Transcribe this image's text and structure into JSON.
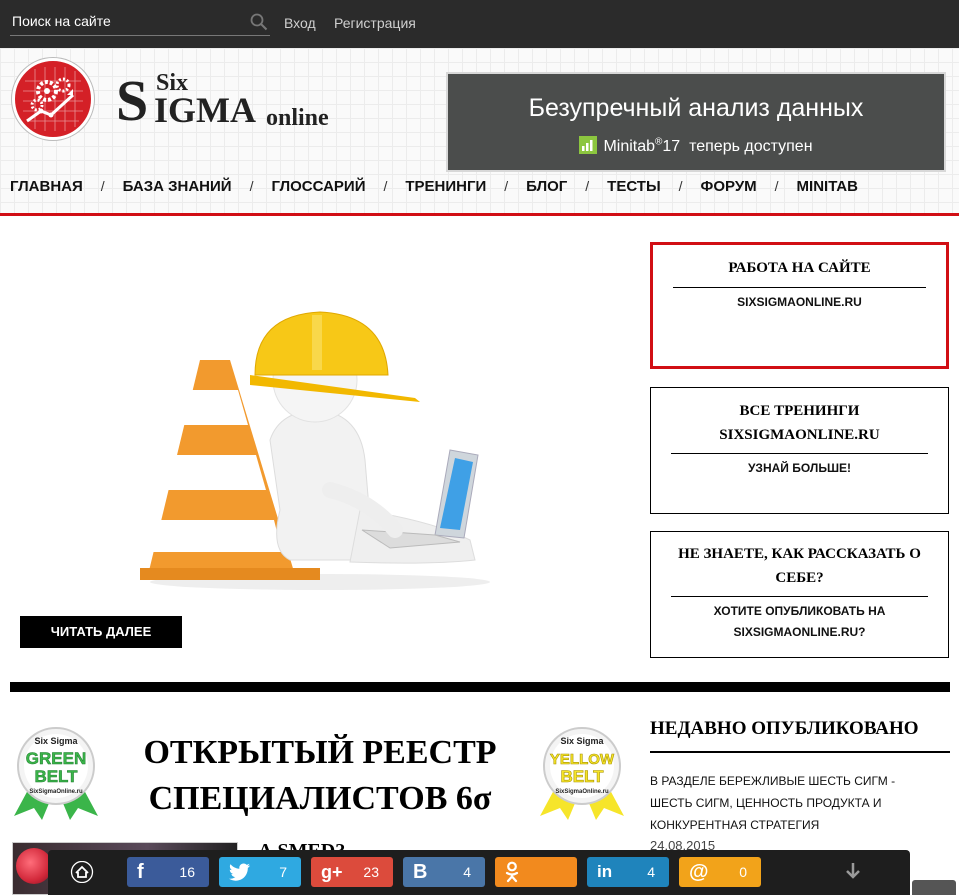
{
  "topbar": {
    "search_placeholder": "Поиск на сайте",
    "login": "Вход",
    "register": "Регистрация"
  },
  "logo": {
    "six": "Six",
    "s": "S",
    "igma": "IGMA",
    "online": "online"
  },
  "banner": {
    "title": "Безупречный анализ данных",
    "product": "Minitab",
    "version": "17",
    "available": "теперь доступен"
  },
  "nav": {
    "items": [
      "ГЛАВНАЯ",
      "БАЗА ЗНАНИЙ",
      "ГЛОССАРИЙ",
      "ТРЕНИНГИ",
      "БЛОГ",
      "ТЕСТЫ",
      "ФОРУМ",
      "MINITAB"
    ],
    "separator": "/"
  },
  "hero": {
    "read_more": "ЧИТАТЬ ДАЛЕЕ"
  },
  "sidebar": {
    "boxes": [
      {
        "title": "РАБОТА НА САЙТЕ",
        "link": "SIXSIGMAONLINE.RU"
      },
      {
        "title": "ВСЕ ТРЕНИНГИ SIXSIGMAONLINE.RU",
        "link": "УЗНАЙ БОЛЬШЕ!"
      },
      {
        "title": "НЕ ЗНАЕТЕ, КАК РАССКАЗАТЬ О СЕБЕ?",
        "link": "ХОТИТЕ ОПУБЛИКОВАТЬ НА SIXSIGMAONLINE.RU?"
      }
    ]
  },
  "registry": {
    "title": "ОТКРЫТЫЙ РЕЕСТР СПЕЦИАЛИСТОВ 6σ",
    "green_badge": {
      "top": "Six Sigma",
      "line1": "GREEN",
      "line2": "BELT",
      "site": "SixSigmaOnline.ru"
    },
    "yellow_badge": {
      "top": "Six Sigma",
      "line1": "YELLOW",
      "line2": "BELT",
      "site": "SixSigmaOnline.ru"
    }
  },
  "recent": {
    "title": "НЕДАВНО ОПУБЛИКОВАНО",
    "link": "В РАЗДЕЛЕ БЕРЕЖЛИВЫЕ ШЕСТЬ СИГМ - ШЕСТЬ СИГМ, ЦЕННОСТЬ ПРОДУКТА И КОНКУРЕНТНАЯ СТРАТЕГИЯ",
    "date": "24.08.2015"
  },
  "article_peek": "А         SMED?",
  "share": {
    "facebook": {
      "glyph": "f",
      "count": "16",
      "color": "#3b5b9a"
    },
    "twitter": {
      "glyph": "t",
      "count": "7",
      "color": "#2fa9e1"
    },
    "googleplus": {
      "glyph": "g+",
      "count": "23",
      "color": "#dc4b3c"
    },
    "vk": {
      "glyph": "B",
      "count": "4",
      "color": "#4a76a8"
    },
    "odnoklassniki": {
      "glyph": "ok",
      "count": "",
      "color": "#f28a1e"
    },
    "linkedin": {
      "glyph": "in",
      "count": "4",
      "color": "#1f84bc"
    },
    "email": {
      "glyph": "@",
      "count": "0",
      "color": "#f2a31a"
    }
  }
}
